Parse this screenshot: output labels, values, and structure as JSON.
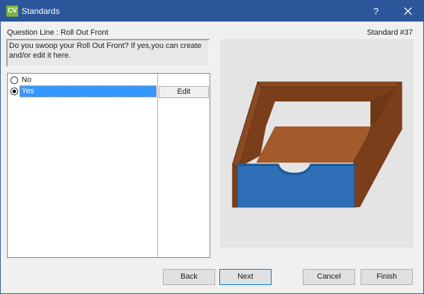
{
  "window": {
    "logo_text": "CV",
    "title": "Standards",
    "help_label": "?"
  },
  "question": {
    "line_label": "Question Line : Roll Out Front",
    "standard_number": "Standard #37",
    "prompt": "Do you swoop your Roll Out Front? If yes,you can create and/or edit it here."
  },
  "options": [
    {
      "label": "No",
      "selected": false
    },
    {
      "label": "Yes",
      "selected": true
    }
  ],
  "edit_label": "Edit",
  "preview": {
    "icon": "drawer-box-icon",
    "colors": {
      "wood": "#8b4a22",
      "interior": "#a35b2c",
      "front": "#2e6fb7"
    }
  },
  "buttons": {
    "back": "Back",
    "next": "Next",
    "cancel": "Cancel",
    "finish": "Finish"
  },
  "colors": {
    "titlebar": "#2b579a",
    "selection": "#3399ff",
    "logo": "#7cb342"
  }
}
